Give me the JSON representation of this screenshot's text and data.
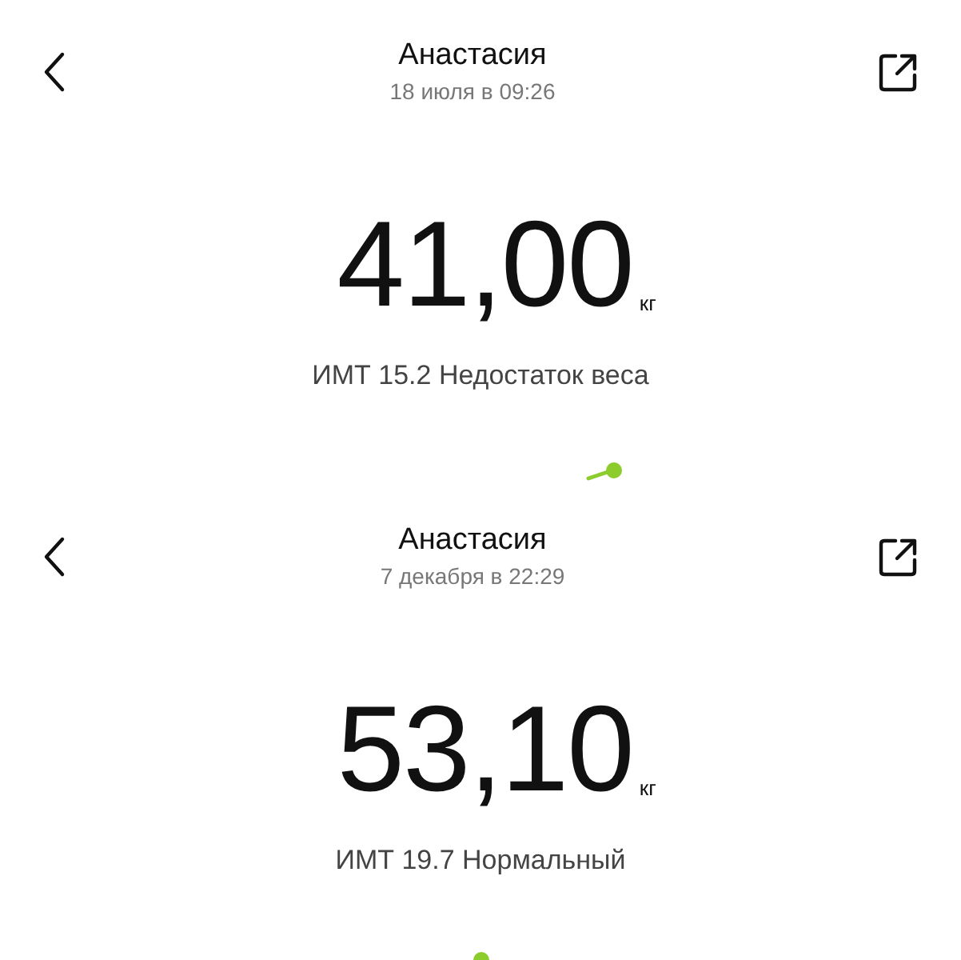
{
  "records": [
    {
      "name": "Анастасия",
      "date": "18 июля в 09:26",
      "weight": "41,00",
      "unit": "кг",
      "bmi": "ИМТ 15.2 Недостаток веса",
      "chart_mark": {
        "kind": "trail"
      }
    },
    {
      "name": "Анастасия",
      "date": "7 декабря в 22:29",
      "weight": "53,10",
      "unit": "кг",
      "bmi": "ИМТ 19.7 Нормальный",
      "chart_mark": {
        "kind": "point"
      }
    }
  ]
}
